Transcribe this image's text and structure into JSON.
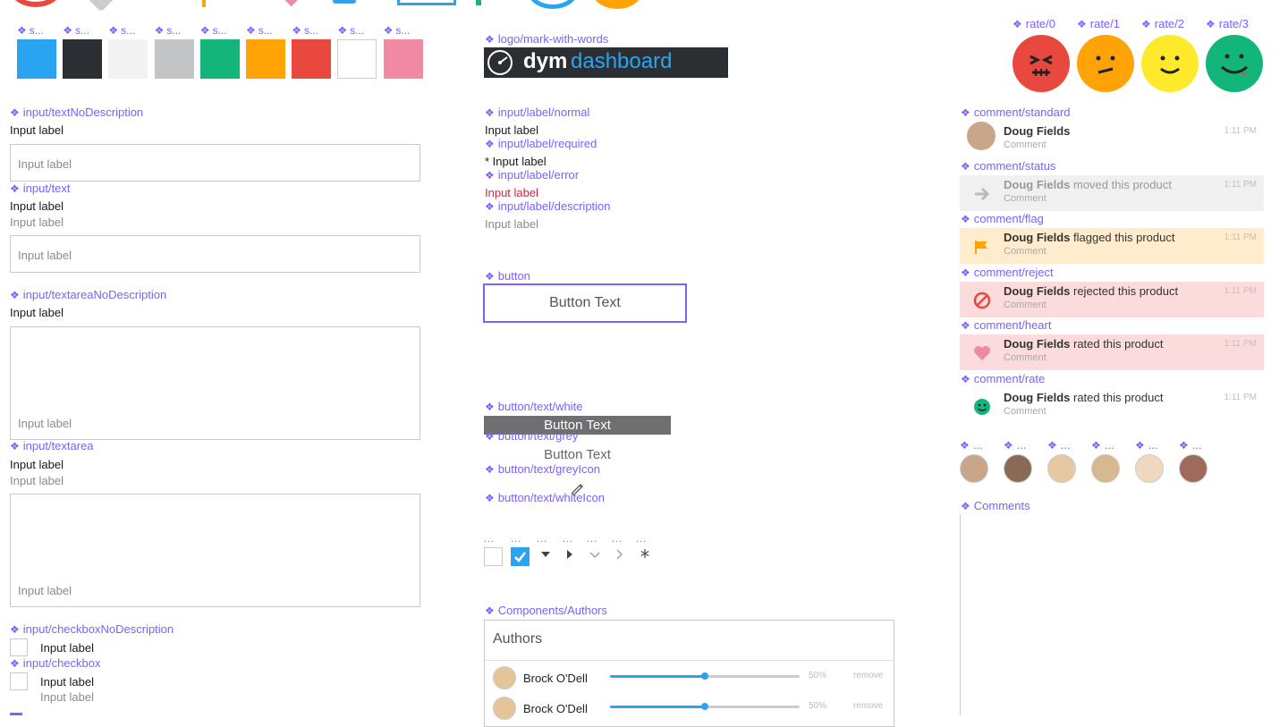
{
  "swatch_label": "s...",
  "swatches": [
    "#2aa4f0",
    "#2b2f33",
    "#f2f2f2",
    "#c2c4c6",
    "#13b57a",
    "#ffa306",
    "#e8483e",
    "#ffffff",
    "#f08aa2"
  ],
  "col1": {
    "textNoDescription": "input/textNoDescription",
    "text": "input/text",
    "textareaNoDescription": "input/textareaNoDescription",
    "textarea": "input/textarea",
    "checkboxNoDescription": "input/checkboxNoDescription",
    "checkbox": "input/checkbox",
    "input_label": "Input label",
    "placeholder": "Input label",
    "checkbox_label": "Input label",
    "checkbox_desc": "Input label"
  },
  "col2": {
    "logo_comp": "logo/mark-with-words",
    "logo_word1": "dym",
    "logo_word2": "dashboard",
    "label_normal": "input/label/normal",
    "label_normal_text": "Input label",
    "label_required": "input/label/required",
    "label_required_text": "* Input label",
    "label_error": "input/label/error",
    "label_error_text": "Input label",
    "label_description": "input/label/description",
    "label_description_text": "Input label",
    "button_comp": "button",
    "button_text": "Button Text",
    "button_white_comp": "button/text/white",
    "button_white_text": "Button Text",
    "button_grey_comp": "button/text/grey",
    "button_grey_text": "Button Text",
    "button_greyicon_comp": "button/text/greyIcon",
    "button_whiteicon_comp": "button/text/whiteIcon",
    "small_dots": "...",
    "authors_comp": "Components/Authors",
    "authors_title": "Authors",
    "authors": [
      {
        "name": "Brock O'Dell",
        "value": 50,
        "pct": "50%",
        "remove": "remove"
      },
      {
        "name": "Brock O'Dell",
        "value": 50,
        "pct": "50%",
        "remove": "remove"
      }
    ]
  },
  "col3": {
    "rates": [
      "rate/0",
      "rate/1",
      "rate/2",
      "rate/3"
    ],
    "rate_colors": [
      "#e8483e",
      "#ffa306",
      "#ffe92b",
      "#13b57a"
    ],
    "comments": [
      {
        "comp": "comment/standard",
        "name": "Doug Fields",
        "action": "",
        "sub": "Comment",
        "time": "1:11 PM",
        "bg": "#ffffff",
        "icon": "avatar"
      },
      {
        "comp": "comment/status",
        "name": "Doug Fields",
        "action": " moved this product",
        "sub": "Comment",
        "time": "1:11 PM",
        "bg": "#f0f0f0",
        "icon": "arrow-right-icon"
      },
      {
        "comp": "comment/flag",
        "name": "Doug Fields",
        "action": " flagged this product",
        "sub": "Comment",
        "time": "1:11 PM",
        "bg": "#ffeccc",
        "icon": "flag-icon"
      },
      {
        "comp": "comment/reject",
        "name": "Doug Fields",
        "action": " rejected this product",
        "sub": "Comment",
        "time": "1:11 PM",
        "bg": "#fbdbdc",
        "icon": "reject-icon"
      },
      {
        "comp": "comment/heart",
        "name": "Doug Fields",
        "action": " rated this product",
        "sub": "Comment",
        "time": "1:11 PM",
        "bg": "#fbdbdc",
        "icon": "heart-icon"
      },
      {
        "comp": "comment/rate",
        "name": "Doug Fields",
        "action": " rated this product",
        "sub": "Comment",
        "time": "1:11 PM",
        "bg": "#ffffff",
        "icon": "smile-icon"
      }
    ],
    "avatar_label": "...",
    "comments_comp": "Comments"
  }
}
